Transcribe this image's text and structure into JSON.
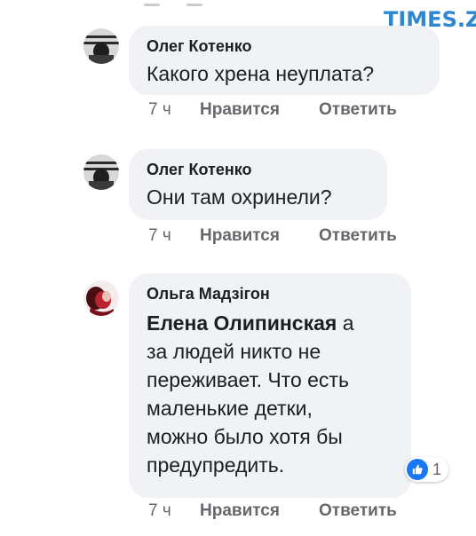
{
  "watermark": {
    "text": "TIMES.ZT"
  },
  "comments": [
    {
      "author": "Олег Котенко",
      "text": "Какого хрена неуплата?",
      "time": "7 ч",
      "like_label": "Нравится",
      "reply_label": "Ответить"
    },
    {
      "author": "Олег Котенко",
      "text": "Они там охринели?",
      "time": "7 ч",
      "like_label": "Нравится",
      "reply_label": "Ответить"
    },
    {
      "author": "Ольга Мадзігон",
      "mention": "Елена Олипинская",
      "text_lines": [
        "а",
        "за людей никто не",
        "переживает. Что есть",
        "маленькие детки,",
        "можно было хотя бы",
        "предупредить."
      ],
      "time": "7 ч",
      "like_label": "Нравится",
      "reply_label": "Ответить",
      "reactions": {
        "icon": "thumbs-up-icon",
        "count": "1"
      }
    }
  ],
  "colors": {
    "bubble": "#f0f2f5",
    "meta_text": "#65676b",
    "like_blue": "#1877f2",
    "watermark": "#2f86d1"
  }
}
